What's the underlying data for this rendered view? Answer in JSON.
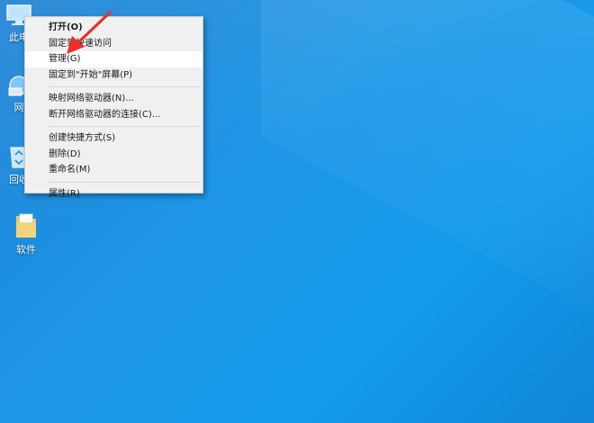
{
  "desktop": {
    "icons": [
      {
        "label": "此电"
      },
      {
        "label": "网"
      },
      {
        "label": "回收"
      },
      {
        "label": "软件"
      }
    ]
  },
  "context_menu": {
    "items": [
      {
        "label": "打开(O)"
      },
      {
        "label": "固定到快速访问"
      },
      {
        "label": "管理(G)"
      },
      {
        "label": "固定到\"开始\"屏幕(P)"
      },
      {
        "label": "映射网络驱动器(N)..."
      },
      {
        "label": "断开网络驱动器的连接(C)..."
      },
      {
        "label": "创建快捷方式(S)"
      },
      {
        "label": "删除(D)"
      },
      {
        "label": "重命名(M)"
      },
      {
        "label": "属性(R)"
      }
    ]
  },
  "colors": {
    "desktop_bg": "#1e96e6",
    "menu_bg": "#f0f0f0",
    "hover_bg": "#ffffff",
    "annotation_arrow": "#e8302a"
  }
}
